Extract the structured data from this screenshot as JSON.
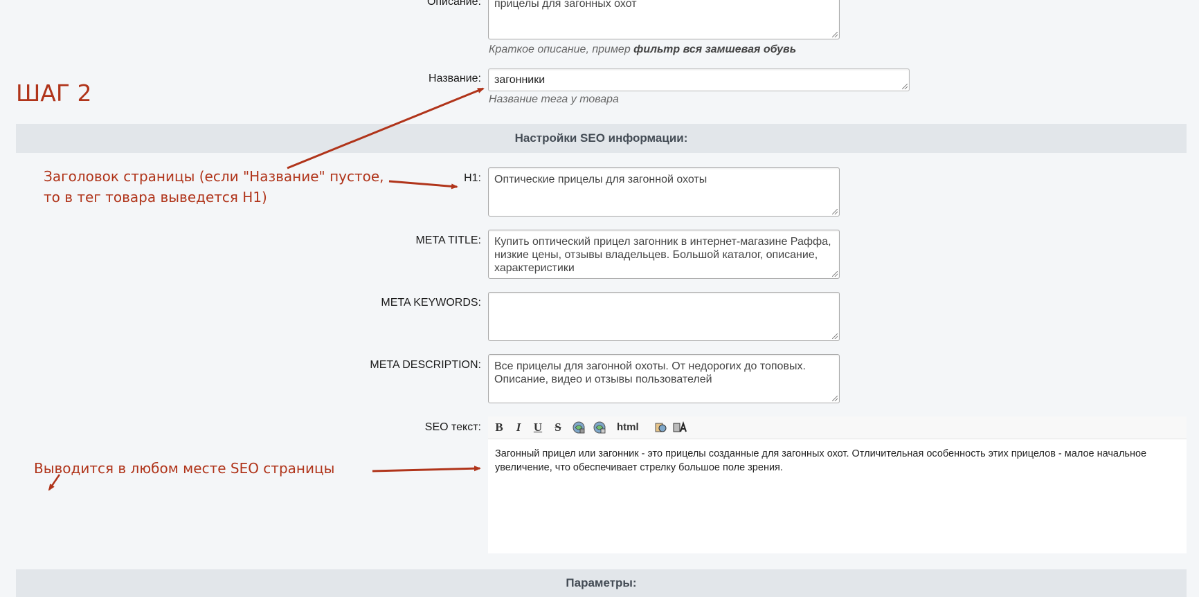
{
  "fields": {
    "description": {
      "label": "Описание:",
      "value": "прицелы для загонных охот",
      "hint_prefix": "Краткое описание, пример ",
      "hint_bold": "фильтр вся замшевая обувь"
    },
    "name": {
      "label": "Название:",
      "value": "загонники",
      "hint": "Название тега у товара"
    }
  },
  "seo_section": {
    "title": "Настройки SEO информации:",
    "h1": {
      "label": "H1:",
      "value": "Оптические прицелы для загонной охоты"
    },
    "meta_title": {
      "label": "META TITLE:",
      "value": "Купить оптический прицел загонник в интернет-магазине Раффа, низкие цены, отзывы владельцев. Большой каталог, описание, характеристики"
    },
    "meta_keywords": {
      "label": "META KEYWORDS:",
      "value": ""
    },
    "meta_description": {
      "label": "META DESCRIPTION:",
      "value": "Все прицелы для загонной охоты. От недорогих до топовых. Описание, видео и отзывы пользователей"
    },
    "seo_text": {
      "label": "SEO текст:",
      "toolbar": {
        "bold": "B",
        "italic": "I",
        "underline": "U",
        "strike": "S",
        "html": "html"
      },
      "value": "Загонный прицел или загонник - это прицелы созданные для загонных охот. Отличительная особенность этих прицелов - малое начальное увеличение, что обеспечивает стрелку большое поле зрения."
    }
  },
  "params_section": {
    "title": "Параметры:"
  },
  "annotations": {
    "step": "ШАГ 2",
    "h1_note_line1": "Заголовок страницы (если \"Название\" пустое,",
    "h1_note_line2": "то в тег товара выведется H1)",
    "seo_note": "Выводится в любом месте SEO страницы",
    "color": "#b0341a"
  }
}
